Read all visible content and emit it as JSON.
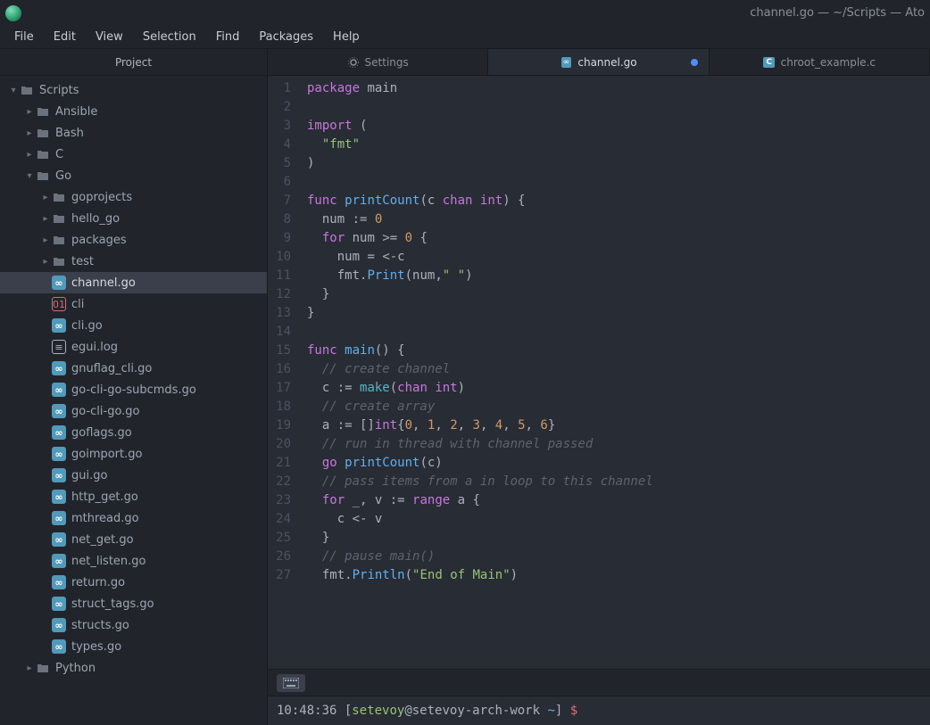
{
  "window": {
    "title": "channel.go — ~/Scripts — Ato"
  },
  "menu": {
    "items": [
      "File",
      "Edit",
      "View",
      "Selection",
      "Find",
      "Packages",
      "Help"
    ]
  },
  "sidebar": {
    "header": "Project",
    "tree": [
      {
        "depth": 0,
        "arrow": "down",
        "icon": "folder",
        "label": "Scripts"
      },
      {
        "depth": 1,
        "arrow": "right",
        "icon": "folder",
        "label": "Ansible"
      },
      {
        "depth": 1,
        "arrow": "right",
        "icon": "folder",
        "label": "Bash"
      },
      {
        "depth": 1,
        "arrow": "right",
        "icon": "folder",
        "label": "C"
      },
      {
        "depth": 1,
        "arrow": "down",
        "icon": "folder",
        "label": "Go"
      },
      {
        "depth": 2,
        "arrow": "right",
        "icon": "folder",
        "label": "goprojects"
      },
      {
        "depth": 2,
        "arrow": "right",
        "icon": "folder",
        "label": "hello_go"
      },
      {
        "depth": 2,
        "arrow": "right",
        "icon": "folder",
        "label": "packages"
      },
      {
        "depth": 2,
        "arrow": "right",
        "icon": "folder",
        "label": "test"
      },
      {
        "depth": 2,
        "arrow": "none",
        "icon": "go",
        "label": "channel.go",
        "selected": true
      },
      {
        "depth": 2,
        "arrow": "none",
        "icon": "binary",
        "label": "cli"
      },
      {
        "depth": 2,
        "arrow": "none",
        "icon": "go",
        "label": "cli.go"
      },
      {
        "depth": 2,
        "arrow": "none",
        "icon": "log",
        "label": "egui.log"
      },
      {
        "depth": 2,
        "arrow": "none",
        "icon": "go",
        "label": "gnuflag_cli.go"
      },
      {
        "depth": 2,
        "arrow": "none",
        "icon": "go",
        "label": "go-cli-go-subcmds.go"
      },
      {
        "depth": 2,
        "arrow": "none",
        "icon": "go",
        "label": "go-cli-go.go"
      },
      {
        "depth": 2,
        "arrow": "none",
        "icon": "go",
        "label": "goflags.go"
      },
      {
        "depth": 2,
        "arrow": "none",
        "icon": "go",
        "label": "goimport.go"
      },
      {
        "depth": 2,
        "arrow": "none",
        "icon": "go",
        "label": "gui.go"
      },
      {
        "depth": 2,
        "arrow": "none",
        "icon": "go",
        "label": "http_get.go"
      },
      {
        "depth": 2,
        "arrow": "none",
        "icon": "go",
        "label": "mthread.go"
      },
      {
        "depth": 2,
        "arrow": "none",
        "icon": "go",
        "label": "net_get.go"
      },
      {
        "depth": 2,
        "arrow": "none",
        "icon": "go",
        "label": "net_listen.go"
      },
      {
        "depth": 2,
        "arrow": "none",
        "icon": "go",
        "label": "return.go"
      },
      {
        "depth": 2,
        "arrow": "none",
        "icon": "go",
        "label": "struct_tags.go"
      },
      {
        "depth": 2,
        "arrow": "none",
        "icon": "go",
        "label": "structs.go"
      },
      {
        "depth": 2,
        "arrow": "none",
        "icon": "go",
        "label": "types.go"
      },
      {
        "depth": 1,
        "arrow": "right",
        "icon": "folder",
        "label": "Python"
      }
    ]
  },
  "tabs": [
    {
      "icon": "gear",
      "label": "Settings",
      "active": false,
      "modified": false
    },
    {
      "icon": "go",
      "label": "channel.go",
      "active": true,
      "modified": true
    },
    {
      "icon": "c",
      "label": "chroot_example.c",
      "active": false,
      "modified": false
    }
  ],
  "editor": {
    "line_numbers": [
      1,
      2,
      3,
      4,
      5,
      6,
      7,
      8,
      9,
      10,
      11,
      12,
      13,
      14,
      15,
      16,
      17,
      18,
      19,
      20,
      21,
      22,
      23,
      24,
      25,
      26,
      27
    ],
    "lines": [
      [
        {
          "t": "package",
          "c": "kw"
        },
        {
          "t": " main",
          "c": "punct"
        }
      ],
      [],
      [
        {
          "t": "import",
          "c": "kw"
        },
        {
          "t": " (",
          "c": "punct"
        }
      ],
      [
        {
          "t": "  ",
          "c": "punct"
        },
        {
          "t": "\"fmt\"",
          "c": "str"
        }
      ],
      [
        {
          "t": ")",
          "c": "punct"
        }
      ],
      [],
      [
        {
          "t": "func",
          "c": "kw"
        },
        {
          "t": " ",
          "c": "punct"
        },
        {
          "t": "printCount",
          "c": "fn"
        },
        {
          "t": "(c ",
          "c": "punct"
        },
        {
          "t": "chan",
          "c": "typ"
        },
        {
          "t": " ",
          "c": "punct"
        },
        {
          "t": "int",
          "c": "typ"
        },
        {
          "t": ") {",
          "c": "punct"
        }
      ],
      [
        {
          "t": "  num ",
          "c": "punct"
        },
        {
          "t": ":=",
          "c": "punct"
        },
        {
          "t": " ",
          "c": "punct"
        },
        {
          "t": "0",
          "c": "num"
        }
      ],
      [
        {
          "t": "  ",
          "c": "punct"
        },
        {
          "t": "for",
          "c": "kw"
        },
        {
          "t": " num ",
          "c": "punct"
        },
        {
          "t": ">=",
          "c": "punct"
        },
        {
          "t": " ",
          "c": "punct"
        },
        {
          "t": "0",
          "c": "num"
        },
        {
          "t": " {",
          "c": "punct"
        }
      ],
      [
        {
          "t": "    num ",
          "c": "punct"
        },
        {
          "t": "=",
          "c": "punct"
        },
        {
          "t": " ",
          "c": "punct"
        },
        {
          "t": "<-",
          "c": "punct"
        },
        {
          "t": "c",
          "c": "punct"
        }
      ],
      [
        {
          "t": "    fmt",
          "c": "punct"
        },
        {
          "t": ".",
          "c": "punct"
        },
        {
          "t": "Print",
          "c": "fn"
        },
        {
          "t": "(num",
          "c": "punct"
        },
        {
          "t": ",",
          "c": "punct"
        },
        {
          "t": "\" \"",
          "c": "str"
        },
        {
          "t": ")",
          "c": "punct"
        }
      ],
      [
        {
          "t": "  }",
          "c": "punct"
        }
      ],
      [
        {
          "t": "}",
          "c": "punct"
        }
      ],
      [],
      [
        {
          "t": "func",
          "c": "kw"
        },
        {
          "t": " ",
          "c": "punct"
        },
        {
          "t": "main",
          "c": "fn"
        },
        {
          "t": "() {",
          "c": "punct"
        }
      ],
      [
        {
          "t": "  ",
          "c": "punct"
        },
        {
          "t": "// create channel",
          "c": "cmt"
        }
      ],
      [
        {
          "t": "  c ",
          "c": "punct"
        },
        {
          "t": ":=",
          "c": "punct"
        },
        {
          "t": " ",
          "c": "punct"
        },
        {
          "t": "make",
          "c": "builtin"
        },
        {
          "t": "(",
          "c": "punct"
        },
        {
          "t": "chan",
          "c": "typ"
        },
        {
          "t": " ",
          "c": "punct"
        },
        {
          "t": "int",
          "c": "typ"
        },
        {
          "t": ")",
          "c": "punct"
        }
      ],
      [
        {
          "t": "  ",
          "c": "punct"
        },
        {
          "t": "// create array",
          "c": "cmt"
        }
      ],
      [
        {
          "t": "  a ",
          "c": "punct"
        },
        {
          "t": ":=",
          "c": "punct"
        },
        {
          "t": " []",
          "c": "punct"
        },
        {
          "t": "int",
          "c": "typ"
        },
        {
          "t": "{",
          "c": "punct"
        },
        {
          "t": "0",
          "c": "num"
        },
        {
          "t": ", ",
          "c": "punct"
        },
        {
          "t": "1",
          "c": "num"
        },
        {
          "t": ", ",
          "c": "punct"
        },
        {
          "t": "2",
          "c": "num"
        },
        {
          "t": ", ",
          "c": "punct"
        },
        {
          "t": "3",
          "c": "num"
        },
        {
          "t": ", ",
          "c": "punct"
        },
        {
          "t": "4",
          "c": "num"
        },
        {
          "t": ", ",
          "c": "punct"
        },
        {
          "t": "5",
          "c": "num"
        },
        {
          "t": ", ",
          "c": "punct"
        },
        {
          "t": "6",
          "c": "num"
        },
        {
          "t": "}",
          "c": "punct"
        }
      ],
      [
        {
          "t": "  ",
          "c": "punct"
        },
        {
          "t": "// run in thread with channel passed",
          "c": "cmt"
        }
      ],
      [
        {
          "t": "  ",
          "c": "punct"
        },
        {
          "t": "go",
          "c": "kw"
        },
        {
          "t": " ",
          "c": "punct"
        },
        {
          "t": "printCount",
          "c": "fn"
        },
        {
          "t": "(c)",
          "c": "punct"
        }
      ],
      [
        {
          "t": "  ",
          "c": "punct"
        },
        {
          "t": "// pass items from a in loop to this channel",
          "c": "cmt"
        }
      ],
      [
        {
          "t": "  ",
          "c": "punct"
        },
        {
          "t": "for",
          "c": "kw"
        },
        {
          "t": " _",
          "c": "punct"
        },
        {
          "t": ",",
          "c": "punct"
        },
        {
          "t": " v ",
          "c": "punct"
        },
        {
          "t": ":=",
          "c": "punct"
        },
        {
          "t": " ",
          "c": "punct"
        },
        {
          "t": "range",
          "c": "kw"
        },
        {
          "t": " a {",
          "c": "punct"
        }
      ],
      [
        {
          "t": "    c ",
          "c": "punct"
        },
        {
          "t": "<-",
          "c": "punct"
        },
        {
          "t": " v",
          "c": "punct"
        }
      ],
      [
        {
          "t": "  }",
          "c": "punct"
        }
      ],
      [
        {
          "t": "  ",
          "c": "punct"
        },
        {
          "t": "// pause main()",
          "c": "cmt"
        }
      ],
      [
        {
          "t": "  fmt",
          "c": "punct"
        },
        {
          "t": ".",
          "c": "punct"
        },
        {
          "t": "Println",
          "c": "fn"
        },
        {
          "t": "(",
          "c": "punct"
        },
        {
          "t": "\"End of Main\"",
          "c": "str"
        },
        {
          "t": ")",
          "c": "punct"
        }
      ]
    ]
  },
  "terminal": {
    "time": "10:48:36",
    "user": "setevoy",
    "host": "setevoy-arch-work",
    "cwd": "~",
    "prompt": "$"
  }
}
